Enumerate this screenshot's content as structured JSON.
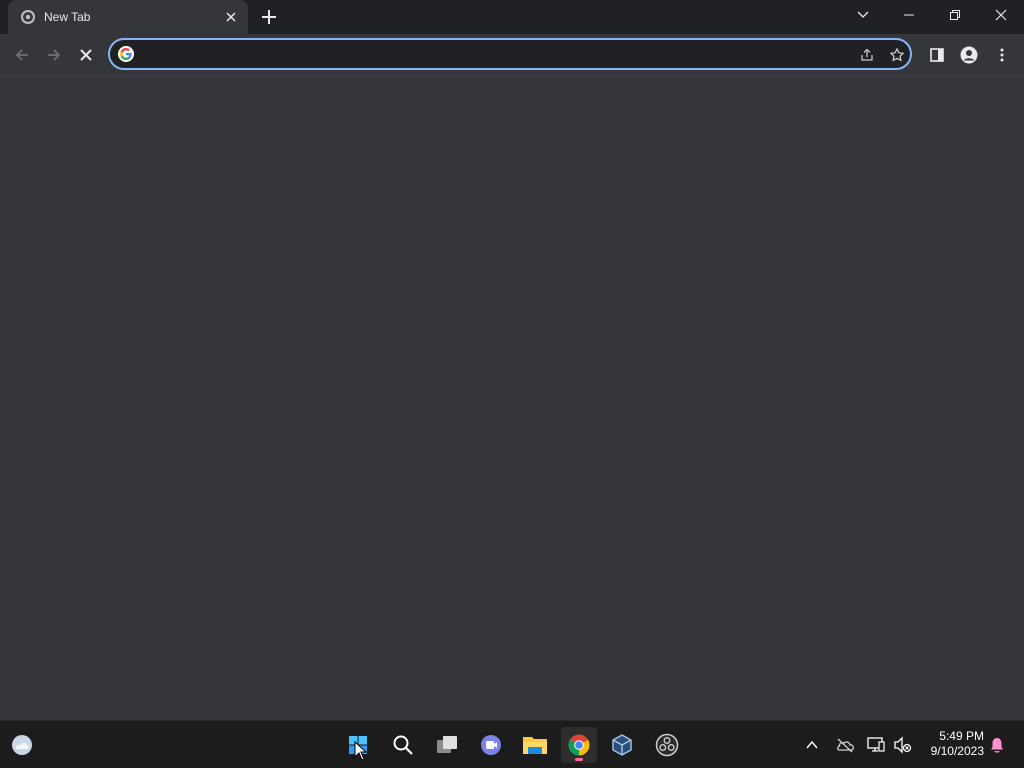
{
  "browser": {
    "tab": {
      "title": "New Tab"
    },
    "omnibox": {
      "value": "",
      "placeholder": ""
    }
  },
  "taskbar": {
    "clock": {
      "time": "5:49 PM",
      "date": "9/10/2023"
    },
    "pinned": [
      "widgets-icon",
      "start-icon",
      "search-icon",
      "task-view-icon",
      "teams-icon",
      "file-explorer-icon",
      "chrome-icon",
      "virtualbox-icon",
      "obs-icon"
    ],
    "tray": [
      "show-hidden-icons",
      "onedrive-icon",
      "network-icon",
      "volume-muted-icon",
      "notifications-icon"
    ]
  },
  "colors": {
    "accent": "#8ab4f8",
    "content_bg": "#35363a",
    "tabstrip_bg": "#202124",
    "taskbar_bg": "#1c1c1c",
    "notification": "#ff8fd0"
  }
}
